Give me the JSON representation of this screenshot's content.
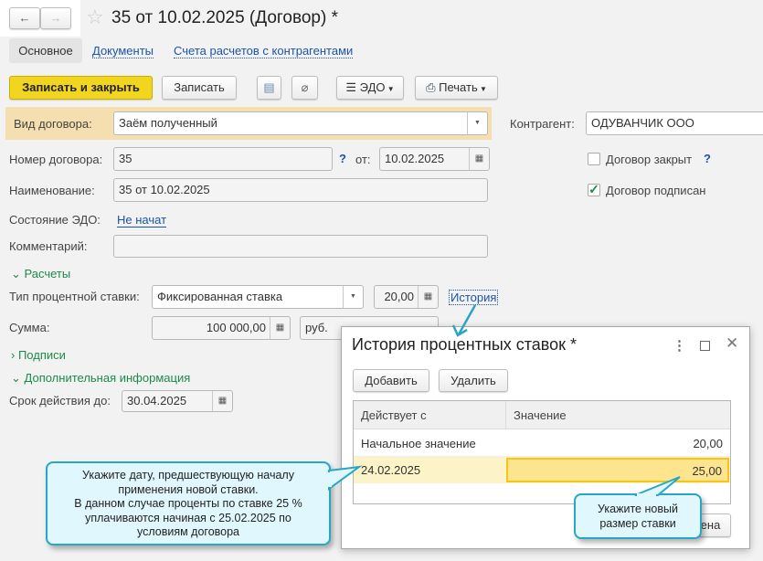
{
  "header": {
    "title": "35 от 10.02.2025 (Договор) *",
    "back": "←",
    "forward": "→"
  },
  "tabs": [
    {
      "label": "Основное",
      "active": true
    },
    {
      "label": "Документы"
    },
    {
      "label": "Счета расчетов с контрагентами"
    }
  ],
  "toolbar": {
    "save_close": "Записать и закрыть",
    "save": "Записать",
    "edo": "ЭДО",
    "print": "Печать"
  },
  "form": {
    "kind_label": "Вид договора:",
    "kind_value": "Заём полученный",
    "counterparty_label": "Контрагент:",
    "counterparty_value": "ОДУВАНЧИК ООО",
    "number_label": "Номер договора:",
    "number_value": "35",
    "help": "?",
    "from_label": "от:",
    "date_value": "10.02.2025",
    "closed_label": "Договор закрыт",
    "closed_checked": false,
    "signed_label": "Договор подписан",
    "signed_checked": true,
    "name_label": "Наименование:",
    "name_value": "35 от 10.02.2025",
    "edo_state_label": "Состояние ЭДО:",
    "edo_state_value": "Не начат",
    "comment_label": "Комментарий:",
    "comment_value": "",
    "settlements_group": "Расчеты",
    "rate_type_label": "Тип процентной ставки:",
    "rate_type_value": "Фиксированная ставка",
    "rate_value": "20,00",
    "history_link": "История",
    "sum_label": "Сумма:",
    "sum_value": "100 000,00",
    "currency": "руб.",
    "signatures_group": "Подписи",
    "extra_group": "Дополнительная информация",
    "valid_until_label": "Срок действия до:",
    "valid_until_value": "30.04.2025"
  },
  "dialog": {
    "title": "История процентных ставок *",
    "add": "Добавить",
    "delete": "Удалить",
    "columns": [
      "Действует с",
      "Значение"
    ],
    "rows": [
      {
        "from": "Начальное значение",
        "value": "20,00"
      },
      {
        "from": "24.02.2025",
        "value": "25,00"
      }
    ],
    "cancel": "Отмена"
  },
  "callouts": {
    "left": [
      "Укажите дату, предшествующую началу",
      "применения новой ставки.",
      "В данном случае проценты по ставке 25 %",
      "уплачиваются начиная с 25.02.2025 по",
      "условиям договора"
    ],
    "right": [
      "Укажите новый",
      "размер ставки"
    ]
  },
  "colors": {
    "primary_button": "#f2d51e",
    "highlight_row": "#f5deb0",
    "link": "#1b54a8",
    "group": "#1b8a49",
    "callout_border": "#28a6c6",
    "selected_cell": "#fde58f"
  }
}
